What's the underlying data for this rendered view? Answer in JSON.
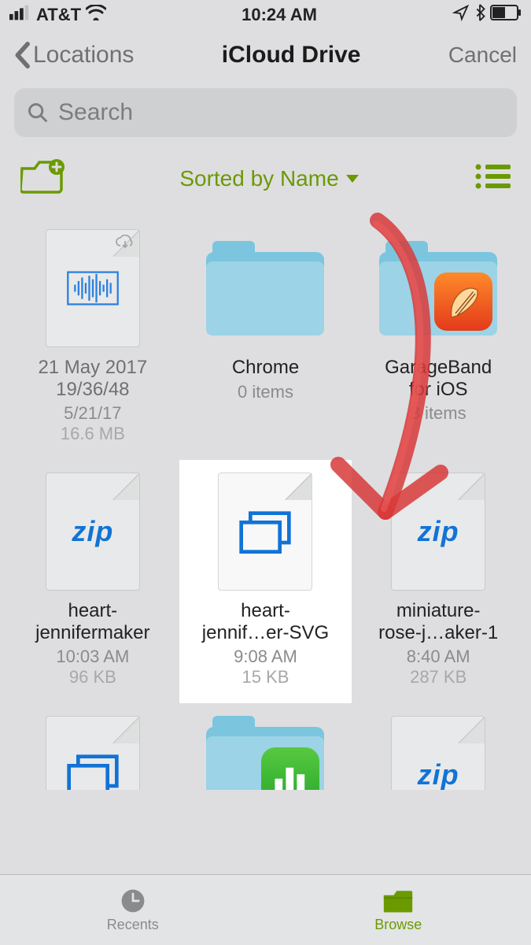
{
  "statusbar": {
    "carrier": "AT&T",
    "time": "10:24 AM"
  },
  "nav": {
    "back_label": "Locations",
    "title": "iCloud Drive",
    "cancel": "Cancel"
  },
  "search": {
    "placeholder": "Search"
  },
  "toolbar": {
    "sort_label": "Sorted by Name"
  },
  "items": [
    {
      "kind": "audio-file",
      "name1": "21 May 2017",
      "name2": "19/36/48",
      "meta1": "5/21/17",
      "meta2": "16.6 MB",
      "dim": true
    },
    {
      "kind": "folder",
      "name1": "Chrome",
      "meta1": "0 items"
    },
    {
      "kind": "folder-garageband",
      "name1": "GarageBand",
      "name2": "for iOS",
      "meta1": "3 items"
    },
    {
      "kind": "zip",
      "name1": "heart-",
      "name2": "jennifermaker",
      "meta1": "10:03 AM",
      "meta2": "96 KB"
    },
    {
      "kind": "svg",
      "name1": "heart-",
      "name2": "jennif…er-SVG",
      "meta1": "9:08 AM",
      "meta2": "15 KB",
      "highlight": true
    },
    {
      "kind": "zip",
      "name1": "miniature-",
      "name2": "rose-j…aker-1",
      "meta1": "8:40 AM",
      "meta2": "287 KB"
    },
    {
      "kind": "svg",
      "partial": true
    },
    {
      "kind": "folder-numbers",
      "partial": true
    },
    {
      "kind": "zip",
      "partial": true
    }
  ],
  "tabs": {
    "recents": "Recents",
    "browse": "Browse"
  },
  "colors": {
    "accent": "#6b9a00",
    "folder": "#9cd3e6",
    "link_blue": "#1173d6"
  }
}
